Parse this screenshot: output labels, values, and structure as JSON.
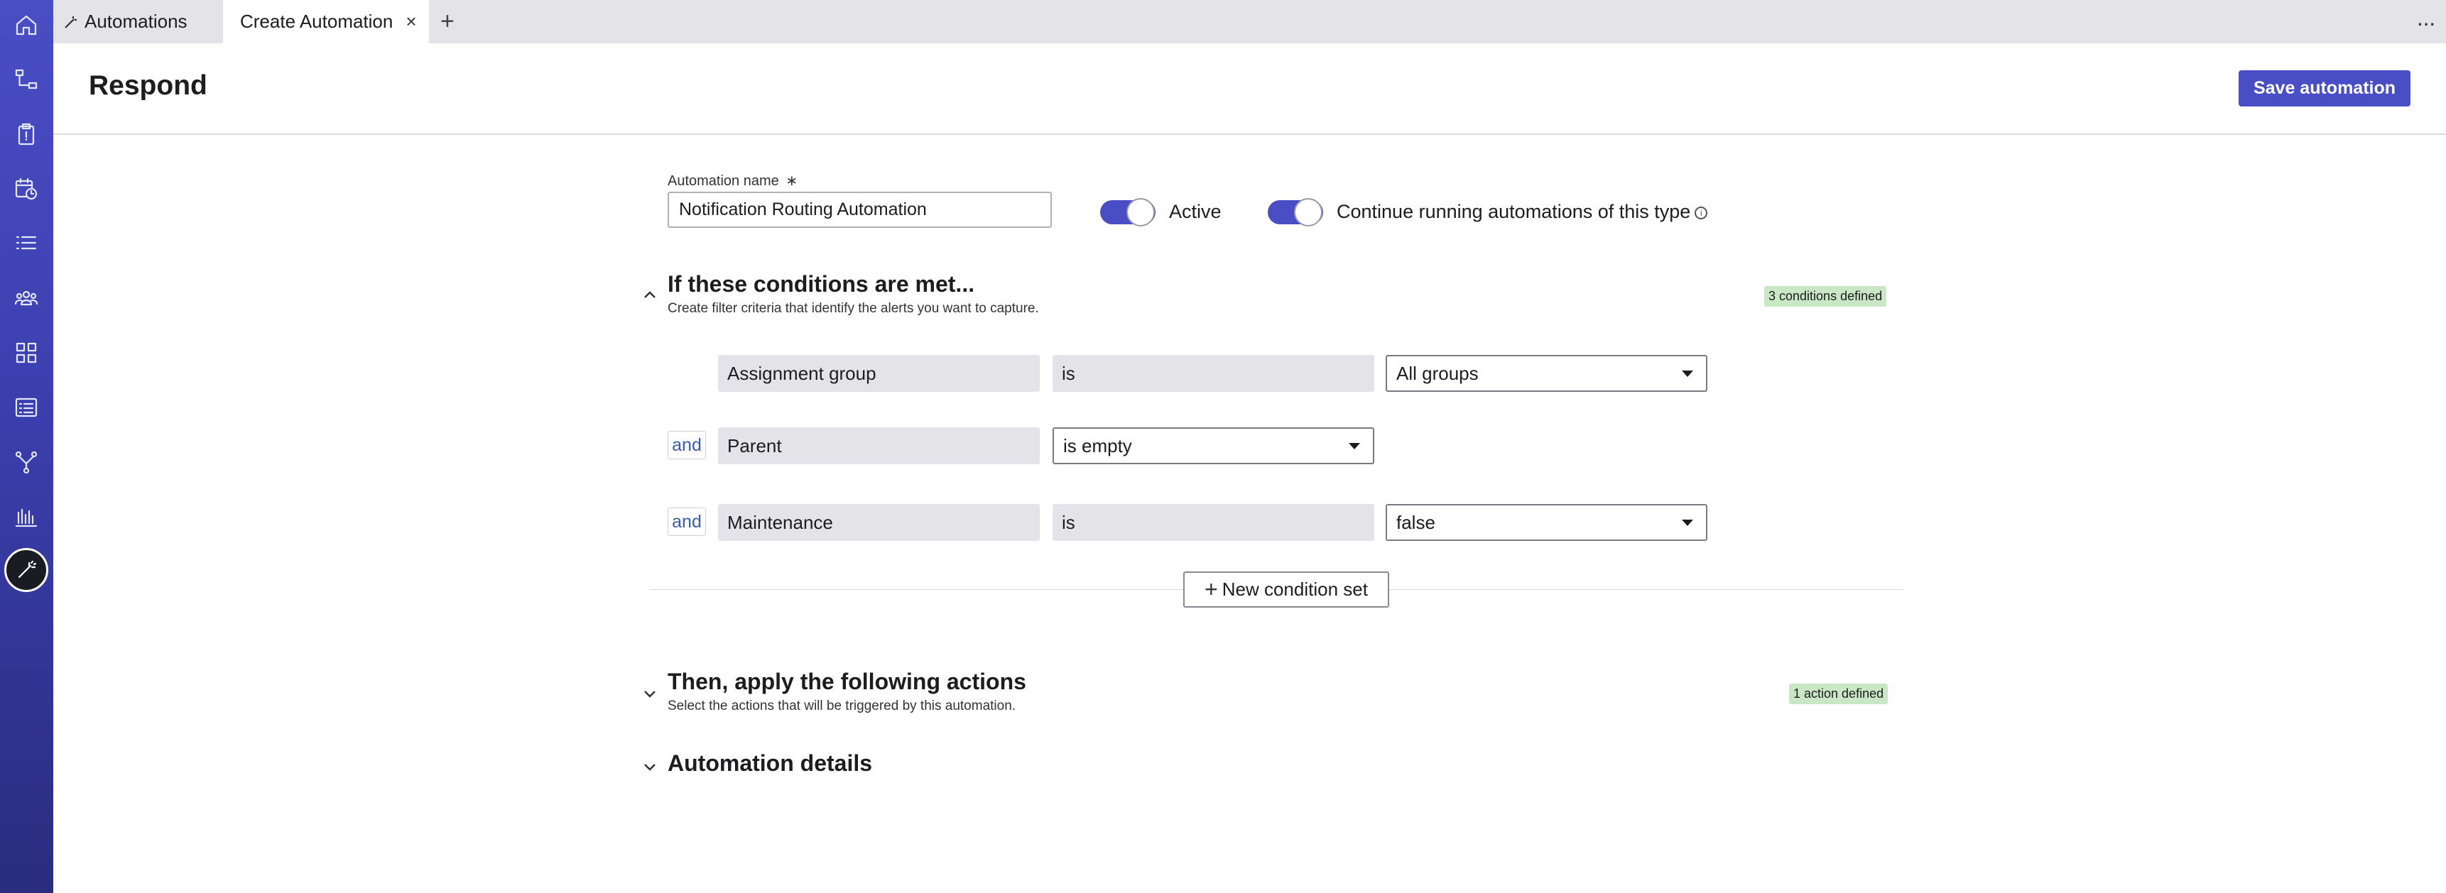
{
  "tabs": {
    "first_label": "Automations",
    "active_label": "Create Automation",
    "close_glyph": "×",
    "add_glyph": "+",
    "more_glyph": "···"
  },
  "header": {
    "title": "Respond",
    "save_label": "Save automation"
  },
  "form": {
    "name_label": "Automation name",
    "required_mark": "∗",
    "name_value": "Notification Routing Automation",
    "active_label": "Active",
    "continue_label": "Continue running automations of this type",
    "info_glyph": "i"
  },
  "conditions": {
    "title": "If these conditions are met...",
    "subtitle": "Create filter criteria that identify the alerts you want to capture.",
    "badge": "3 conditions defined",
    "rows": [
      {
        "connector": "",
        "field": "Assignment group",
        "operator": "is",
        "value": "All groups"
      },
      {
        "connector": "and",
        "field": "Parent",
        "operator": "is empty",
        "value": ""
      },
      {
        "connector": "and",
        "field": "Maintenance",
        "operator": "is",
        "value": "false"
      }
    ],
    "new_set_label": "New condition set"
  },
  "actions": {
    "title": "Then, apply the following actions",
    "subtitle": "Select the actions that will be triggered by this automation.",
    "badge": "1 action defined"
  },
  "details": {
    "title": "Automation details"
  },
  "colors": {
    "accent": "#4a4ec4",
    "badge_bg": "#c9e7c4",
    "link": "#3a5da8"
  },
  "sidebar_icons": [
    "home-icon",
    "workflow-icon",
    "clipboard-icon",
    "calendar-clock-icon",
    "list-icon",
    "team-icon",
    "grid-icon",
    "form-list-icon",
    "branch-icon",
    "bar-chart-icon",
    "magic-wand-icon"
  ]
}
